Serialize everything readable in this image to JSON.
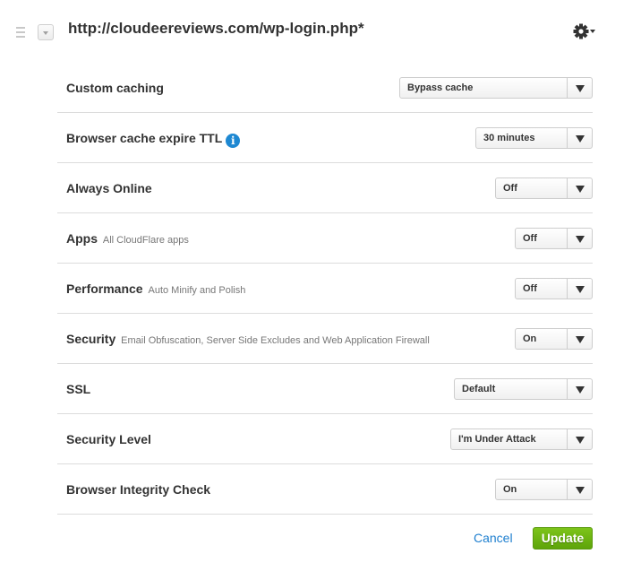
{
  "header": {
    "title": "http://cloudeereviews.com/wp-login.php*",
    "drag_icon": "drag-handle-icon",
    "collapse_icon": "chevron-down-icon",
    "settings_icon": "gear-icon"
  },
  "settings": [
    {
      "label": "Custom caching",
      "description": "",
      "value": "Bypass cache",
      "has_info": false
    },
    {
      "label": "Browser cache expire TTL",
      "description": "",
      "value": "30 minutes",
      "has_info": true,
      "info_glyph": "i"
    },
    {
      "label": "Always Online",
      "description": "",
      "value": "Off",
      "has_info": false
    },
    {
      "label": "Apps",
      "description": "All CloudFlare apps",
      "value": "Off",
      "has_info": false
    },
    {
      "label": "Performance",
      "description": "Auto Minify and Polish",
      "value": "Off",
      "has_info": false
    },
    {
      "label": "Security",
      "description": "Email Obfuscation, Server Side Excludes and Web Application Firewall",
      "value": "On",
      "has_info": false
    },
    {
      "label": "SSL",
      "description": "",
      "value": "Default",
      "has_info": false
    },
    {
      "label": "Security Level",
      "description": "",
      "value": "I'm Under Attack",
      "has_info": false
    },
    {
      "label": "Browser Integrity Check",
      "description": "",
      "value": "On",
      "has_info": false
    }
  ],
  "actions": {
    "cancel_label": "Cancel",
    "update_label": "Update"
  },
  "colors": {
    "accent_link": "#1e7fcf",
    "update_button": "#6cb412",
    "info_icon": "#1e88d2"
  }
}
